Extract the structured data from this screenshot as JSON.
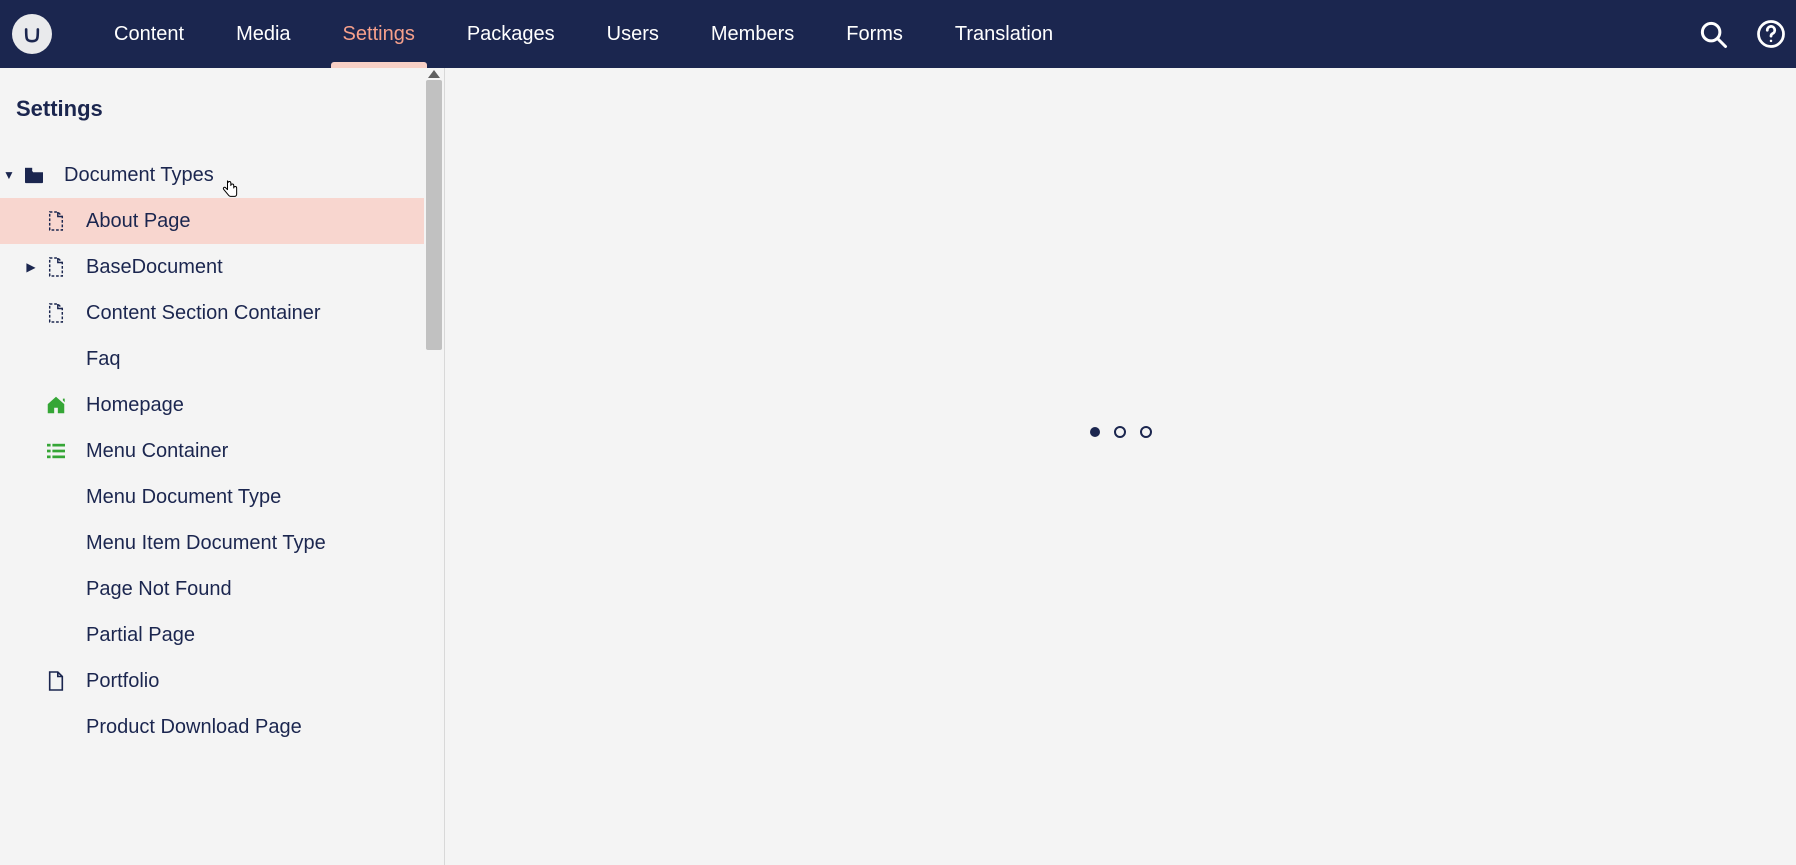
{
  "topnav": {
    "items": [
      {
        "label": "Content",
        "active": false
      },
      {
        "label": "Media",
        "active": false
      },
      {
        "label": "Settings",
        "active": true
      },
      {
        "label": "Packages",
        "active": false
      },
      {
        "label": "Users",
        "active": false
      },
      {
        "label": "Members",
        "active": false
      },
      {
        "label": "Forms",
        "active": false
      },
      {
        "label": "Translation",
        "active": false
      }
    ]
  },
  "sidebar": {
    "title": "Settings",
    "root": {
      "label": "Document Types"
    },
    "items": [
      {
        "label": "About Page",
        "icon": "file-dashed",
        "selected": true,
        "expandable": false
      },
      {
        "label": "BaseDocument",
        "icon": "file-dashed",
        "selected": false,
        "expandable": true
      },
      {
        "label": "Content Section Container",
        "icon": "file-dashed",
        "selected": false,
        "expandable": false
      },
      {
        "label": "Faq",
        "icon": "none",
        "selected": false,
        "expandable": false
      },
      {
        "label": "Homepage",
        "icon": "home",
        "selected": false,
        "expandable": false
      },
      {
        "label": "Menu Container",
        "icon": "list",
        "selected": false,
        "expandable": false
      },
      {
        "label": "Menu Document Type",
        "icon": "none",
        "selected": false,
        "expandable": false
      },
      {
        "label": "Menu Item Document Type",
        "icon": "none",
        "selected": false,
        "expandable": false
      },
      {
        "label": "Page Not Found",
        "icon": "none",
        "selected": false,
        "expandable": false
      },
      {
        "label": "Partial Page",
        "icon": "none",
        "selected": false,
        "expandable": false
      },
      {
        "label": "Portfolio",
        "icon": "file",
        "selected": false,
        "expandable": false
      },
      {
        "label": "Product Download Page",
        "icon": "none",
        "selected": false,
        "expandable": false
      }
    ]
  },
  "colors": {
    "navbar": "#1b264f",
    "accent_peach": "#f8d6cf",
    "text_dark": "#1b264f",
    "icon_green": "#35a636"
  }
}
